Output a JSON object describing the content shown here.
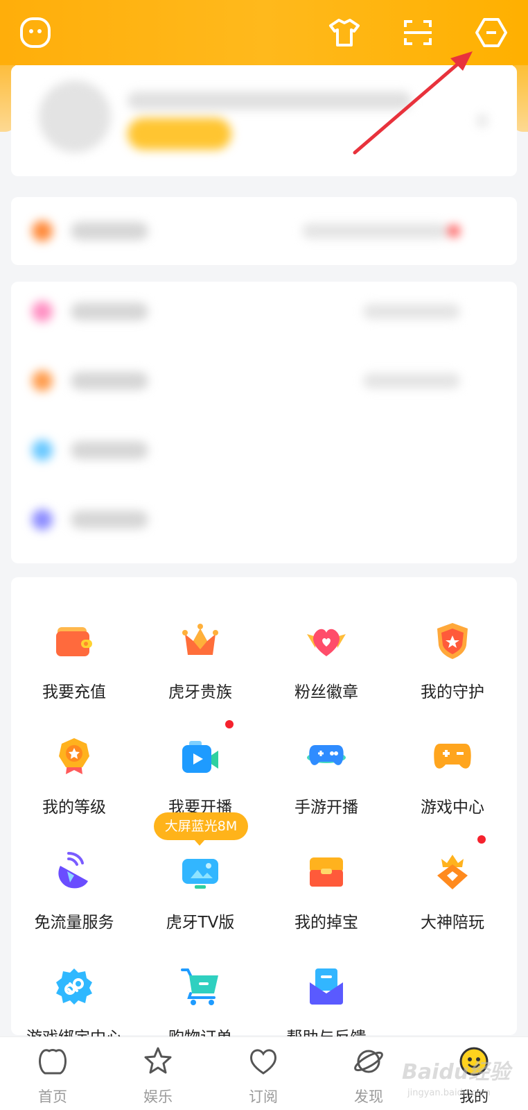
{
  "header": {
    "icons": [
      "face-icon",
      "tshirt-icon",
      "scan-icon",
      "settings-icon"
    ],
    "accent_color": "#ffb000"
  },
  "services": {
    "items": [
      {
        "label": "我要充值",
        "icon": "wallet-icon"
      },
      {
        "label": "虎牙贵族",
        "icon": "crown-icon"
      },
      {
        "label": "粉丝徽章",
        "icon": "heart-badge-icon"
      },
      {
        "label": "我的守护",
        "icon": "shield-star-icon"
      },
      {
        "label": "我的等级",
        "icon": "medal-icon"
      },
      {
        "label": "我要开播",
        "icon": "video-camera-icon"
      },
      {
        "label": "手游开播",
        "icon": "gamepad-planet-icon"
      },
      {
        "label": "游戏中心",
        "icon": "gamepad-icon"
      },
      {
        "label": "免流量服务",
        "icon": "satellite-icon"
      },
      {
        "label": "虎牙TV版",
        "icon": "tv-icon"
      },
      {
        "label": "我的掉宝",
        "icon": "treasure-box-icon"
      },
      {
        "label": "大神陪玩",
        "icon": "diamond-crown-icon"
      },
      {
        "label": "游戏绑定中心",
        "icon": "link-icon"
      },
      {
        "label": "购物订单",
        "icon": "cart-icon"
      },
      {
        "label": "帮助与反馈",
        "icon": "mail-help-icon"
      }
    ],
    "tv_badge": "大屏蓝光8M",
    "notification_dot_color": "#f5222d"
  },
  "bottom_nav": {
    "items": [
      {
        "label": "首页",
        "icon": "tiger-home-icon"
      },
      {
        "label": "娱乐",
        "icon": "star-icon"
      },
      {
        "label": "订阅",
        "icon": "heart-icon"
      },
      {
        "label": "发现",
        "icon": "planet-icon"
      },
      {
        "label": "我的",
        "icon": "avatar-icon",
        "active": true
      }
    ]
  },
  "watermark": {
    "text": "Baidu经验",
    "sub": "jingyan.baidu.com"
  }
}
